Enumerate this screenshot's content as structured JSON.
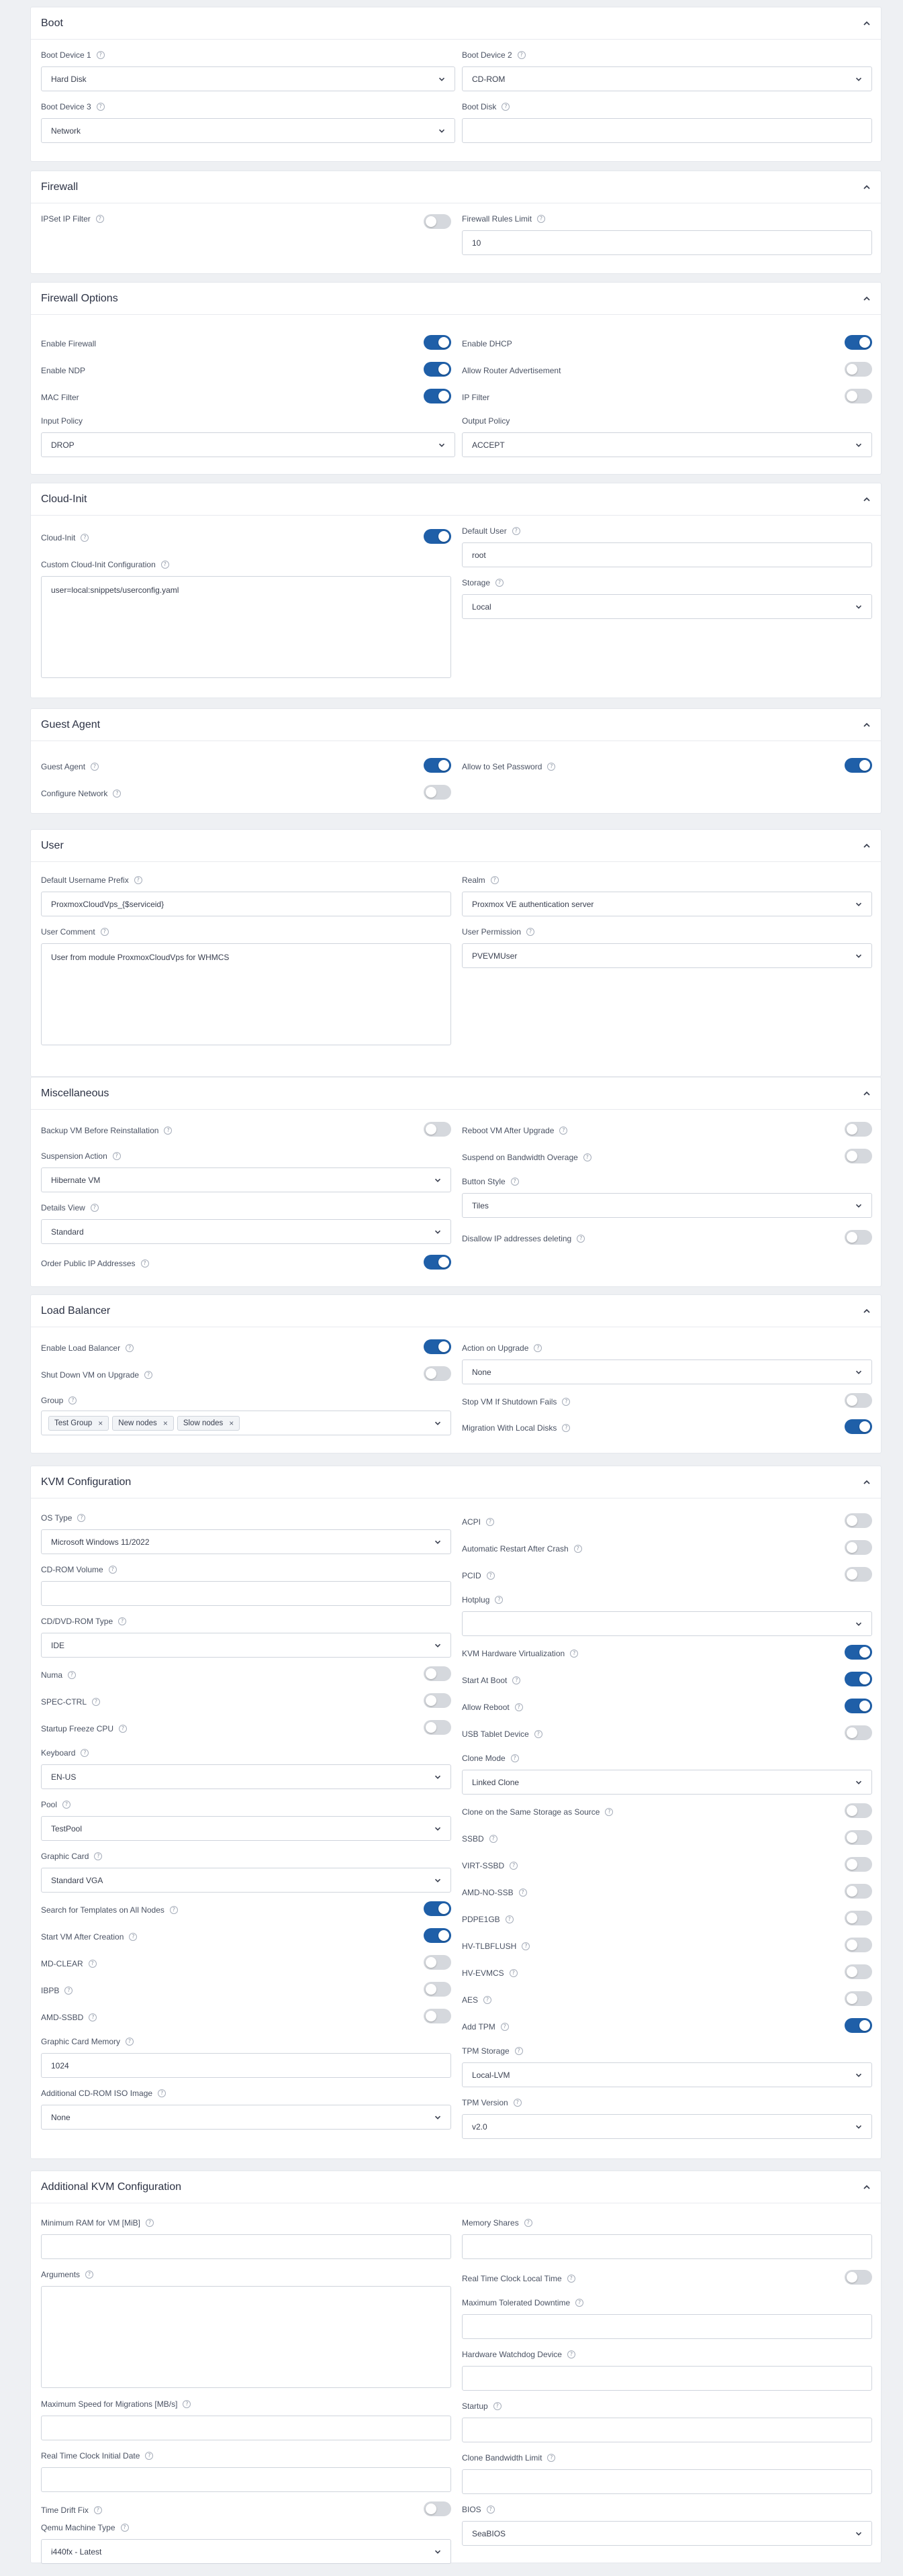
{
  "boot": {
    "title": "Boot",
    "d1_label": "Boot Device 1",
    "d1_value": "Hard Disk",
    "d2_label": "Boot Device 2",
    "d2_value": "CD-ROM",
    "d3_label": "Boot Device 3",
    "d3_value": "Network",
    "disk_label": "Boot Disk",
    "disk_value": ""
  },
  "firewall": {
    "title": "Firewall",
    "ipset_label": "IPSet IP Filter",
    "ipset_on": false,
    "limit_label": "Firewall Rules Limit",
    "limit_value": "10"
  },
  "fwopts": {
    "title": "Firewall Options",
    "enable_fw": "Enable Firewall",
    "enable_fw_on": true,
    "enable_dhcp": "Enable DHCP",
    "enable_dhcp_on": true,
    "enable_ndp": "Enable NDP",
    "enable_ndp_on": true,
    "allow_ra": "Allow Router Advertisement",
    "allow_ra_on": false,
    "mac_filter": "MAC Filter",
    "mac_filter_on": true,
    "ip_filter": "IP Filter",
    "ip_filter_on": false,
    "input_label": "Input Policy",
    "input_value": "DROP",
    "output_label": "Output Policy",
    "output_value": "ACCEPT"
  },
  "cloudinit": {
    "title": "Cloud-Init",
    "ci_label": "Cloud-Init",
    "ci_on": true,
    "user_label": "Default User",
    "user_value": "root",
    "custom_label": "Custom Cloud-Init Configuration",
    "custom_value": "user=local:snippets/userconfig.yaml",
    "storage_label": "Storage",
    "storage_value": "Local"
  },
  "guest": {
    "title": "Guest Agent",
    "ga_label": "Guest Agent",
    "ga_on": true,
    "pwd_label": "Allow to Set Password",
    "pwd_on": true,
    "net_label": "Configure Network",
    "net_on": false
  },
  "user": {
    "title": "User",
    "prefix_label": "Default Username Prefix",
    "prefix_value": "ProxmoxCloudVps_{$serviceid}",
    "realm_label": "Realm",
    "realm_value": "Proxmox VE authentication server",
    "comment_label": "User Comment",
    "comment_value": "User from module ProxmoxCloudVps for WHMCS",
    "perm_label": "User Permission",
    "perm_value": "PVEVMUser"
  },
  "misc": {
    "title": "Miscellaneous",
    "backup_label": "Backup VM Before Reinstallation",
    "backup_on": false,
    "reboot_label": "Reboot VM After Upgrade",
    "reboot_on": false,
    "susp_label": "Suspension Action",
    "susp_value": "Hibernate VM",
    "bw_label": "Suspend on Bandwidth Overage",
    "bw_on": false,
    "button_label": "Button Style",
    "button_value": "Tiles",
    "details_label": "Details View",
    "details_value": "Standard",
    "disallow_label": "Disallow IP addresses deleting",
    "disallow_on": false,
    "order_label": "Order Public IP Addresses",
    "order_on": true
  },
  "lb": {
    "title": "Load Balancer",
    "enable_label": "Enable Load Balancer",
    "enable_on": true,
    "action_label": "Action on Upgrade",
    "action_value": "None",
    "shut_label": "Shut Down VM on Upgrade",
    "shut_on": false,
    "group_label": "Group",
    "groups": [
      "Test Group",
      "New nodes",
      "Slow nodes"
    ],
    "stop_label": "Stop VM If Shutdown Fails",
    "stop_on": false,
    "migr_label": "Migration With Local Disks",
    "migr_on": true
  },
  "kvm": {
    "title": "KVM Configuration",
    "os_label": "OS Type",
    "os_value": "Microsoft Windows 11/2022",
    "acpi": "ACPI",
    "acpi_on": false,
    "auto_restart": "Automatic Restart After Crash",
    "auto_restart_on": false,
    "cdrom_label": "CD-ROM Volume",
    "cdrom_value": "",
    "pcid": "PCID",
    "pcid_on": false,
    "hotplug_label": "Hotplug",
    "hotplug_value": "",
    "cddvd_label": "CD/DVD-ROM Type",
    "cddvd_value": "IDE",
    "kvmhw": "KVM Hardware Virtualization",
    "kvmhw_on": true,
    "numa": "Numa",
    "numa_on": false,
    "startboot": "Start At Boot",
    "startboot_on": true,
    "specctrl": "SPEC-CTRL",
    "specctrl_on": false,
    "allowreboot": "Allow Reboot",
    "allowreboot_on": true,
    "freeze": "Startup Freeze CPU",
    "freeze_on": false,
    "usb": "USB Tablet Device",
    "usb_on": false,
    "kb_label": "Keyboard",
    "kb_value": "EN-US",
    "clone_label": "Clone Mode",
    "clone_value": "Linked Clone",
    "pool_label": "Pool",
    "pool_value": "TestPool",
    "samestorage": "Clone on the Same Storage as Source",
    "samestorage_on": false,
    "ssbd": "SSBD",
    "ssbd_on": false,
    "gc_label": "Graphic Card",
    "gc_value": "Standard VGA",
    "virtssbd": "VIRT-SSBD",
    "virtssbd_on": false,
    "amdnossb": "AMD-NO-SSB",
    "amdnossb_on": false,
    "search": "Search for Templates on All Nodes",
    "search_on": true,
    "pdpe1gb": "PDPE1GB",
    "pdpe1gb_on": false,
    "startvm": "Start VM After Creation",
    "startvm_on": true,
    "hvtlb": "HV-TLBFLUSH",
    "hvtlb_on": false,
    "mdclear": "MD-CLEAR",
    "mdclear_on": false,
    "hvevmcs": "HV-EVMCS",
    "hvevmcs_on": false,
    "ibpb": "IBPB",
    "ibpb_on": false,
    "aes": "AES",
    "aes_on": false,
    "amdssbd": "AMD-SSBD",
    "amdssbd_on": false,
    "addtpm": "Add TPM",
    "addtpm_on": true,
    "gcmem_label": "Graphic Card Memory",
    "gcmem_value": "1024",
    "tpmstor_label": "TPM Storage",
    "tpmstor_value": "Local-LVM",
    "iso_label": "Additional CD-ROM ISO Image",
    "iso_value": "None",
    "tpmver_label": "TPM Version",
    "tpmver_value": "v2.0"
  },
  "akvm": {
    "title": "Additional KVM Configuration",
    "minram_label": "Minimum RAM for VM [MiB]",
    "minram_value": "",
    "shares_label": "Memory Shares",
    "shares_value": "",
    "args_label": "Arguments",
    "args_value": "",
    "rtc_label": "Real Time Clock Local Time",
    "rtc_on": false,
    "downtime_label": "Maximum Tolerated Downtime",
    "downtime_value": "",
    "watchdog_label": "Hardware Watchdog Device",
    "watchdog_value": "",
    "migspeed_label": "Maximum Speed for Migrations [MB/s]",
    "migspeed_value": "",
    "startup_label": "Startup",
    "startup_value": "",
    "rtcdate_label": "Real Time Clock Initial Date",
    "rtcdate_value": "",
    "clonebw_label": "Clone Bandwidth Limit",
    "clonebw_value": "",
    "drift_label": "Time Drift Fix",
    "drift_on": false,
    "bios_label": "BIOS",
    "bios_value": "SeaBIOS",
    "machine_label": "Qemu Machine Type",
    "machine_value": "i440fx - Latest"
  }
}
